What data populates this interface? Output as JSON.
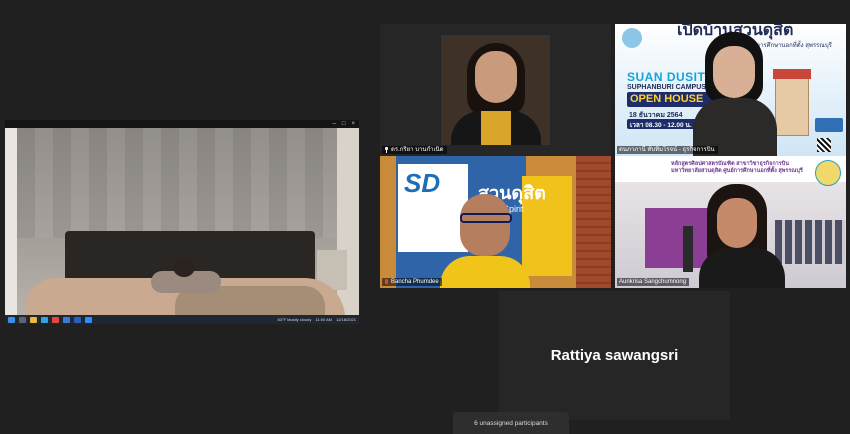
{
  "shared_screen": {
    "window_controls": [
      "–",
      "□",
      "×"
    ],
    "taskbar": {
      "weather": "83°F Mostly cloudy",
      "time": "11:50 AM",
      "date": "12/18/2021"
    }
  },
  "tiles": [
    {
      "name": "ดร.กริยา บานกำเนิด",
      "pinned": true
    },
    {
      "name": "ดนภาภานี ทับทิมโรจน์ - ธุรกิจการบิน",
      "banner": {
        "top": "เปิดบ้านสวนดุสิต",
        "small": "ศูนย์การศึกษานอกที่ตั้ง สุพรรณบุรี",
        "title": "SUAN DUSIT",
        "subtitle": "SUPHANBURI CAMPUS",
        "open": "OPEN HOUSE",
        "date": "18 ธันวาคม 2564",
        "time": "เวลา 08.30 - 12.00 น."
      }
    },
    {
      "name": "Bancha Phumdee",
      "mic_muted": true,
      "backdrop": {
        "logo": "SD",
        "text": "สวนดุสิต",
        "text2": "Dusit Spirit"
      }
    },
    {
      "name": "Aunkrisa Sangchumnong",
      "speaking": true,
      "header": [
        "หลักสูตรศิลปศาสตรบัณฑิต สาขาวิชาธุรกิจการบิน",
        "มหาวิทยาลัยสวนดุสิต ศูนย์การศึกษานอกที่ตั้ง สุพรรณบุรี"
      ]
    }
  ],
  "audio_participant": {
    "name": "Rattiya sawangsri"
  },
  "footer": {
    "unassigned_label": "6 unassigned participants"
  },
  "colors": {
    "speaking_outline": "#e9de56",
    "background": "#202020",
    "tile": "#262626"
  }
}
